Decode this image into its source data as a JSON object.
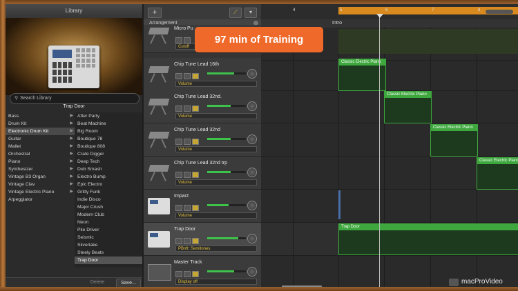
{
  "banner": {
    "text": "97 min of Training"
  },
  "library": {
    "title": "Library",
    "selected_instrument": "Trap Door",
    "search_placeholder": "Search Library",
    "categories": [
      "Bass",
      "Drum Kit",
      "Electronic Drum Kit",
      "Guitar",
      "Mallet",
      "Orchestral",
      "Piano",
      "Synthesizer",
      "Vintage B3 Organ",
      "Vintage Clav",
      "Vintage Electric Piano",
      "Arpeggiator"
    ],
    "selected_category": "Electronic Drum Kit",
    "patches": [
      "After Party",
      "Beat Machine",
      "Big Room",
      "Boutique 78",
      "Boutique 808",
      "Crate Digger",
      "Deep Tech",
      "Dub Smash",
      "Electro Bump",
      "Epic Electro",
      "Gritty Funk",
      "Indie Disco",
      "Major Crush",
      "Modern Club",
      "Neon",
      "Pile Driver",
      "Seismic",
      "Silverlake",
      "Steely Beats",
      "Trap Door"
    ],
    "selected_patch": "Trap Door",
    "delete_label": "Delete",
    "save_label": "Save..."
  },
  "toolbar": {
    "add_label": "+"
  },
  "arrangement_label": "Arrangement",
  "ruler": {
    "bars": [
      "4",
      "5",
      "6",
      "7",
      "8"
    ],
    "section": "Intro"
  },
  "tracks": [
    {
      "name": "Micro Pu",
      "control": "Cutoff",
      "volume": 0
    },
    {
      "name": "Chip Tune Lead 16th",
      "control": "Volume",
      "volume": 0.7
    },
    {
      "name": "Chip Tune Lead 32nd.",
      "control": "Volume",
      "volume": 0.6
    },
    {
      "name": "Chip Tune Lead 32nd",
      "control": "Volume",
      "volume": 0.6
    },
    {
      "name": "Chip Tune Lead 32nd trp",
      "control": "Volume",
      "volume": 0.6
    },
    {
      "name": "Impact",
      "control": "Volume",
      "volume": 0.55
    },
    {
      "name": "Trap Door",
      "control": "PBnft: Semitones",
      "volume": 0.8
    },
    {
      "name": "Master Track",
      "control": "Display off",
      "volume": 0.7
    }
  ],
  "regions": [
    {
      "label": "Classic Electric Piano",
      "track": 1
    },
    {
      "label": "Classic Electric Piano",
      "track": 2
    },
    {
      "label": "Classic Electric Piano",
      "track": 3
    },
    {
      "label": "Classic Electric Piano",
      "track": 4
    },
    {
      "label": "Trap Door",
      "track": 6
    }
  ],
  "watermark": "macProVideo"
}
